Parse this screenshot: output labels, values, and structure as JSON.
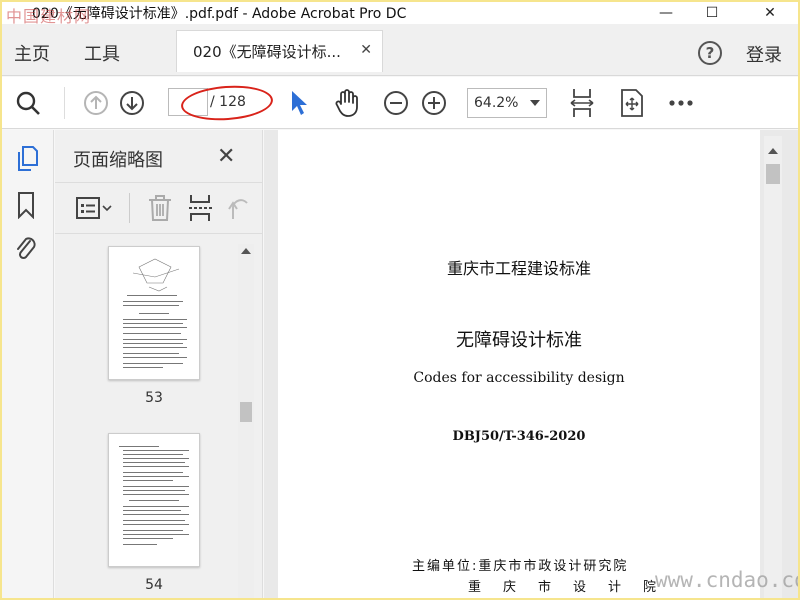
{
  "window": {
    "title": "020《无障碍设计标准》.pdf.pdf - Adobe Acrobat Pro DC",
    "corner_watermark": "中国建材网",
    "minimize": "—",
    "maximize": "☐",
    "close": "✕"
  },
  "menu": {
    "home": "主页",
    "tools": "工具"
  },
  "tab": {
    "label": "020《无障碍设计标...",
    "close": "✕"
  },
  "account": {
    "help": "?",
    "login": "登录"
  },
  "toolbar": {
    "page_current": "",
    "page_total": "/ 128",
    "zoom": "64.2%"
  },
  "thumbnails": {
    "title": "页面缩略图",
    "close": "✕",
    "pages": [
      {
        "label": "53"
      },
      {
        "label": "54"
      }
    ]
  },
  "document": {
    "line1": "重庆市工程建设标准",
    "line2": "无障碍设计标准",
    "line3": "Codes for accessibility design",
    "line4": "DBJ50/T-346-2020",
    "line5": "主编单位:重庆市市政设计研究院",
    "line6": "重庆市设计院"
  },
  "site_watermark": "www.cndao.com",
  "colors": {
    "accent_blue": "#2d6fd6",
    "annotation_red": "#d9231a",
    "border_yellow": "#f6e58d"
  }
}
